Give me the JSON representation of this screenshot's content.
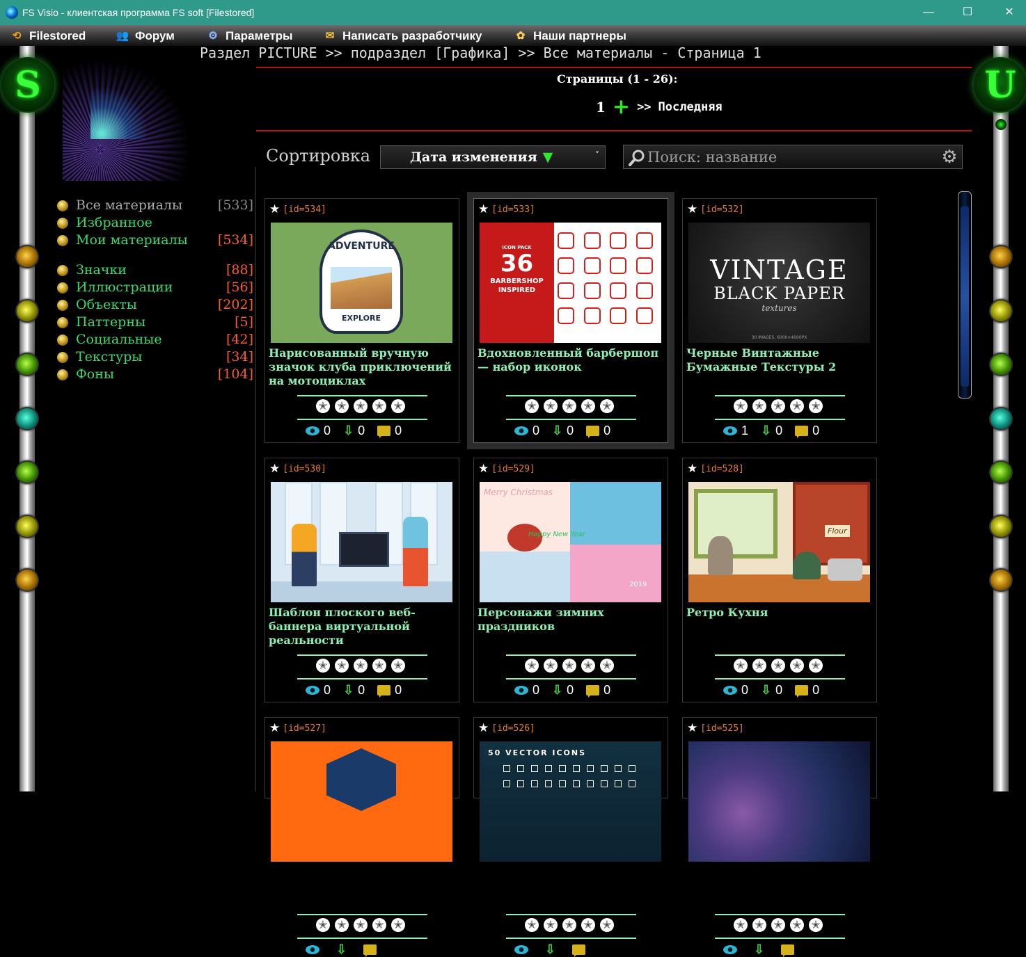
{
  "window": {
    "title": "FS Visio - клиентская программа FS soft [Filestored]",
    "minimize": "—",
    "maximize": "☐",
    "close": "✕"
  },
  "menu": [
    {
      "icon": "filestored-icon",
      "glyph": "⟲",
      "label": "Filestored"
    },
    {
      "icon": "forum-icon",
      "glyph": "👥",
      "label": "Форум"
    },
    {
      "icon": "settings-icon",
      "glyph": "⚙",
      "label": "Параметры"
    },
    {
      "icon": "mail-icon",
      "glyph": "✉",
      "label": "Написать разработчику"
    },
    {
      "icon": "partners-icon",
      "glyph": "✿",
      "label": "Наши партнеры"
    }
  ],
  "badges": {
    "left": "S",
    "right": "U"
  },
  "breadcrumb": "Раздел PICTURE >> подраздел [Графика] >> Все материалы - Страница 1",
  "pagination": {
    "label": "Страницы (1 - 26):",
    "current": "1",
    "plus": "+",
    "next": ">>",
    "last": "Последняя"
  },
  "sort": {
    "label": "Сортировка",
    "value": "Дата изменения",
    "direction_glyph": "▼",
    "chevron": "˅"
  },
  "search": {
    "placeholder": "Поиск: название",
    "value": ""
  },
  "sidebar": {
    "categories": [
      {
        "label": "Все материалы",
        "count": "[533]",
        "muted": true
      },
      {
        "label": "Избранное",
        "count": ""
      },
      {
        "label": "Мои материалы",
        "count": "[534]"
      },
      {
        "label": "Значки",
        "count": "[88]"
      },
      {
        "label": "Иллюстрации",
        "count": "[56]"
      },
      {
        "label": "Объекты",
        "count": "[202]"
      },
      {
        "label": "Паттерны",
        "count": "[5]"
      },
      {
        "label": "Социальные",
        "count": "[42]"
      },
      {
        "label": "Текстуры",
        "count": "[34]"
      },
      {
        "label": "Фоны",
        "count": "[104]"
      }
    ]
  },
  "colors": {
    "accent_green": "#8ff0b4",
    "id_orange": "#e67d2f",
    "count_red": "#ff5a2a",
    "divider_red": "#b01818",
    "titlebar": "#2f9a8a"
  },
  "cards": [
    {
      "id": "[id=534]",
      "title": "Нарисованный вручную значок клуба приключений на мотоциклах",
      "thumb": "adventure",
      "thumb_text": [
        "ADVENTURE",
        "EXPLORE"
      ],
      "views": "0",
      "downloads": "0",
      "comments": "0"
    },
    {
      "id": "[id=533]",
      "title": "Вдохновленный барбершоп — набор иконок",
      "thumb": "barber",
      "thumb_text": [
        "ICON PACK",
        "36",
        "BARBERSHOP",
        "INSPIRED"
      ],
      "views": "0",
      "downloads": "0",
      "comments": "0",
      "selected": true
    },
    {
      "id": "[id=532]",
      "title": "Черные Винтажные Бумажные Текстуры 2",
      "thumb": "vintage",
      "thumb_text": [
        "VINTAGE",
        "BLACK PAPER",
        "textures",
        "30 IMAGES, 6000×4000PX"
      ],
      "views": "1",
      "downloads": "0",
      "comments": "0"
    },
    {
      "id": "[id=530]",
      "title": "Шаблон плоского веб-баннера виртуальной реальности",
      "thumb": "vr",
      "thumb_text": [],
      "views": "0",
      "downloads": "0",
      "comments": "0"
    },
    {
      "id": "[id=529]",
      "title": "Персонажи зимних праздников",
      "thumb": "xmas",
      "thumb_text": [
        "Merry Christmas",
        "Happy New Year",
        "2019"
      ],
      "views": "0",
      "downloads": "0",
      "comments": "0"
    },
    {
      "id": "[id=528]",
      "title": "Ретро Кухня",
      "thumb": "kitchen",
      "thumb_text": [
        "Flour"
      ],
      "views": "0",
      "downloads": "0",
      "comments": "0"
    },
    {
      "id": "[id=527]",
      "title": "",
      "thumb": "geo",
      "thumb_text": [],
      "views": "",
      "downloads": "",
      "comments": ""
    },
    {
      "id": "[id=526]",
      "title": "",
      "thumb": "icons50",
      "thumb_text": [
        "50 VECTOR ICONS"
      ],
      "views": "",
      "downloads": "",
      "comments": ""
    },
    {
      "id": "[id=525]",
      "title": "",
      "thumb": "space",
      "thumb_text": [],
      "views": "",
      "downloads": "",
      "comments": ""
    }
  ]
}
